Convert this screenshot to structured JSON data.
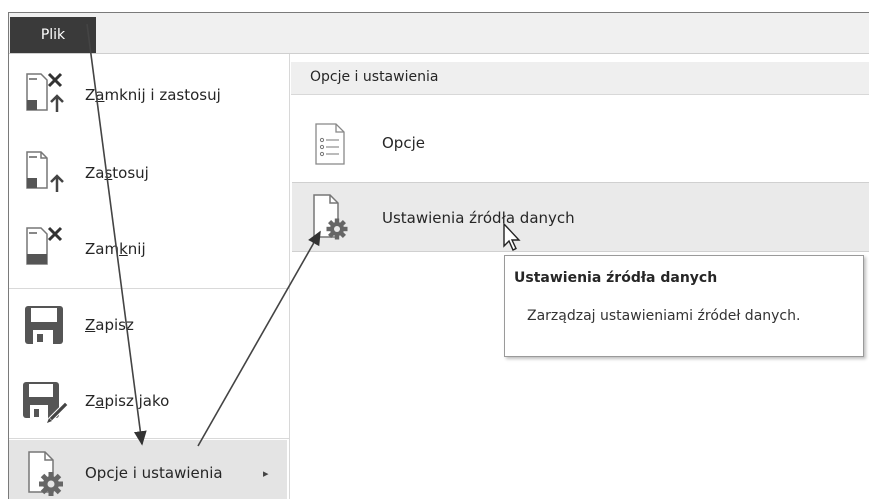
{
  "menubar": {
    "file_tab": "Plik"
  },
  "left_menu": {
    "items": [
      {
        "label_pre": "Z",
        "label_ul": "a",
        "label_post": "mknij i zastosuj",
        "icon": "close-apply-icon"
      },
      {
        "label_pre": "Za",
        "label_ul": "s",
        "label_post": "tosuj",
        "icon": "apply-icon"
      },
      {
        "label_pre": "Zam",
        "label_ul": "k",
        "label_post": "nij",
        "icon": "close-icon"
      },
      {
        "label_pre": "",
        "label_ul": "Z",
        "label_post": "apisz",
        "icon": "save-icon"
      },
      {
        "label_pre": "Z",
        "label_ul": "a",
        "label_post": "pisz jako",
        "icon": "save-as-icon"
      },
      {
        "label_pre": "",
        "label_ul": "",
        "label_post": "Opcje i ustawienia",
        "icon": "options-settings-icon",
        "submenu_arrow": "▸"
      }
    ]
  },
  "right_panel": {
    "header": "Opcje i ustawienia",
    "items": [
      {
        "label": "Opcje",
        "icon": "options-list-icon"
      },
      {
        "label": "Ustawienia źródła danych",
        "icon": "data-source-settings-icon"
      }
    ]
  },
  "tooltip": {
    "title": "Ustawienia źródła danych",
    "body": "Zarządzaj ustawieniami źródeł danych."
  },
  "colors": {
    "file_tab_bg": "#3a3a3a",
    "selected_bg": "#e4e4e4",
    "icon_gray": "#555555"
  }
}
